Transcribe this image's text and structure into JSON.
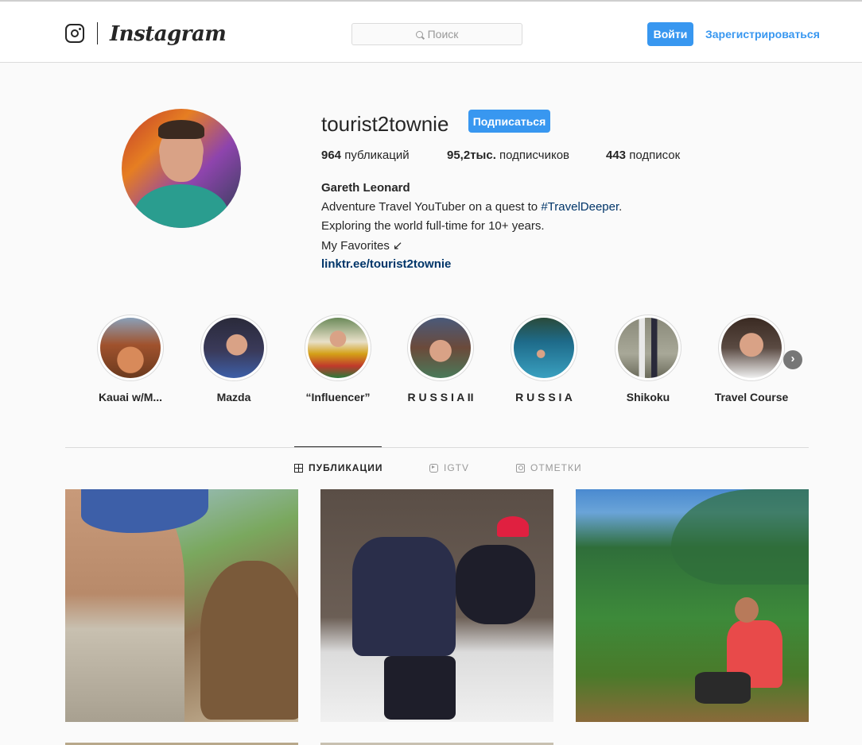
{
  "header": {
    "wordmark": "Instagram",
    "search_placeholder": "Поиск",
    "login_label": "Войти",
    "signup_label": "Зарегистрироваться"
  },
  "profile": {
    "username": "tourist2townie",
    "follow_label": "Подписаться",
    "stats": [
      {
        "value": "964",
        "label": "публикаций"
      },
      {
        "value": "95,2тыс.",
        "label": "подписчиков"
      },
      {
        "value": "443",
        "label": "подписок"
      }
    ],
    "full_name": "Gareth Leonard",
    "bio": {
      "line1_prefix": "Adventure Travel YouTuber on a quest to ",
      "line1_hashtag": "#TravelDeeper",
      "line1_suffix": ".",
      "line2": "Exploring the world full-time for 10+ years.",
      "line3": "My Favorites ↙"
    },
    "link": "linktr.ee/tourist2townie"
  },
  "highlights": [
    {
      "label": "Kauai w/M...",
      "color": "#a0522d"
    },
    {
      "label": "Mazda",
      "color": "#3a3a5a"
    },
    {
      "label": "“Influencer”",
      "color": "#c0392b"
    },
    {
      "label": "R U S S I A II",
      "color": "#6b4a3a"
    },
    {
      "label": "R U S S I A",
      "color": "#1e6b8a"
    },
    {
      "label": "Shikoku",
      "color": "#8a8a7a"
    },
    {
      "label": "Travel Course",
      "color": "#5a4a42"
    }
  ],
  "tabs": [
    {
      "label": "ПУБЛИКАЦИИ",
      "icon": "grid-icon",
      "active": true
    },
    {
      "label": "IGTV",
      "icon": "igtv-icon",
      "active": false
    },
    {
      "label": "ОТМЕТКИ",
      "icon": "tagged-icon",
      "active": false
    }
  ],
  "colors": {
    "accent": "#3897f0",
    "link": "#003569",
    "text": "#262626",
    "background": "#fafafa"
  }
}
